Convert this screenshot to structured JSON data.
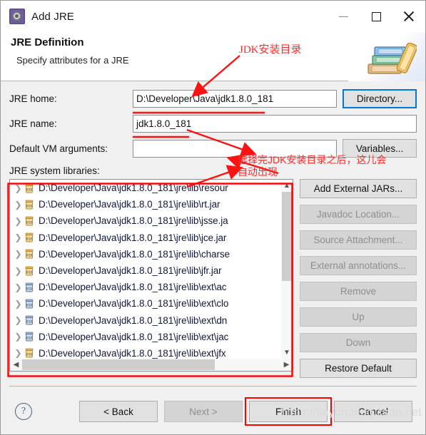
{
  "window": {
    "title": "Add JRE",
    "icon": "jre-gear-icon",
    "controls": {
      "minimize": "minimize-icon",
      "maximize": "maximize-icon",
      "close": "close-icon"
    }
  },
  "wizard": {
    "heading": "JRE Definition",
    "description": "Specify attributes for a JRE",
    "banner_icon": "books-icon"
  },
  "form": {
    "jre_home": {
      "label": "JRE home:",
      "value": "D:\\Developer\\Java\\jdk1.8.0_181",
      "placeholder": "",
      "button": "Directory..."
    },
    "jre_name": {
      "label": "JRE name:",
      "value": "jdk1.8.0_181",
      "placeholder": ""
    },
    "vm_args": {
      "label": "Default VM arguments:",
      "value": "",
      "placeholder": "",
      "button": "Variables..."
    },
    "libraries_label": "JRE system libraries:"
  },
  "libraries": [
    {
      "path": "D:\\Developer\\Java\\jdk1.8.0_181\\jre\\lib\\resour",
      "icon": "jar-source-icon"
    },
    {
      "path": "D:\\Developer\\Java\\jdk1.8.0_181\\jre\\lib\\rt.jar",
      "icon": "jar-source-icon"
    },
    {
      "path": "D:\\Developer\\Java\\jdk1.8.0_181\\jre\\lib\\jsse.ja",
      "icon": "jar-source-icon"
    },
    {
      "path": "D:\\Developer\\Java\\jdk1.8.0_181\\jre\\lib\\jce.jar",
      "icon": "jar-source-icon"
    },
    {
      "path": "D:\\Developer\\Java\\jdk1.8.0_181\\jre\\lib\\charse",
      "icon": "jar-source-icon"
    },
    {
      "path": "D:\\Developer\\Java\\jdk1.8.0_181\\jre\\lib\\jfr.jar",
      "icon": "jar-source-icon"
    },
    {
      "path": "D:\\Developer\\Java\\jdk1.8.0_181\\jre\\lib\\ext\\ac",
      "icon": "jar-icon"
    },
    {
      "path": "D:\\Developer\\Java\\jdk1.8.0_181\\jre\\lib\\ext\\clo",
      "icon": "jar-icon"
    },
    {
      "path": "D:\\Developer\\Java\\jdk1.8.0_181\\jre\\lib\\ext\\dn",
      "icon": "jar-icon"
    },
    {
      "path": "D:\\Developer\\Java\\jdk1.8.0_181\\jre\\lib\\ext\\jac",
      "icon": "jar-icon"
    },
    {
      "path": "D:\\Developer\\Java\\jdk1.8.0_181\\jre\\lib\\ext\\jfx",
      "icon": "jar-source-icon"
    }
  ],
  "side_buttons": [
    {
      "label": "Add External JARs...",
      "enabled": true
    },
    {
      "label": "Javadoc Location...",
      "enabled": false
    },
    {
      "label": "Source Attachment...",
      "enabled": false
    },
    {
      "label": "External annotations...",
      "enabled": false
    },
    {
      "label": "Remove",
      "enabled": false
    },
    {
      "label": "Up",
      "enabled": false
    },
    {
      "label": "Down",
      "enabled": false
    },
    {
      "label": "Restore Default",
      "enabled": true
    }
  ],
  "footer": {
    "help_icon": "help-icon",
    "back": "< Back",
    "next": "Next >",
    "finish": "Finish",
    "cancel": "Cancel"
  },
  "annotations": {
    "jdk_dir": "JDK安装目录",
    "auto_appear": "选择完JDK安装目录之后，这儿会\n自动出现",
    "color": "#ff2b2b"
  },
  "watermark": "https://liayun.blog.csdn.net",
  "scrollbars": {
    "vertical_up": "▲",
    "vertical_down": "▼",
    "horizontal_left": "◄",
    "horizontal_right": "►"
  }
}
